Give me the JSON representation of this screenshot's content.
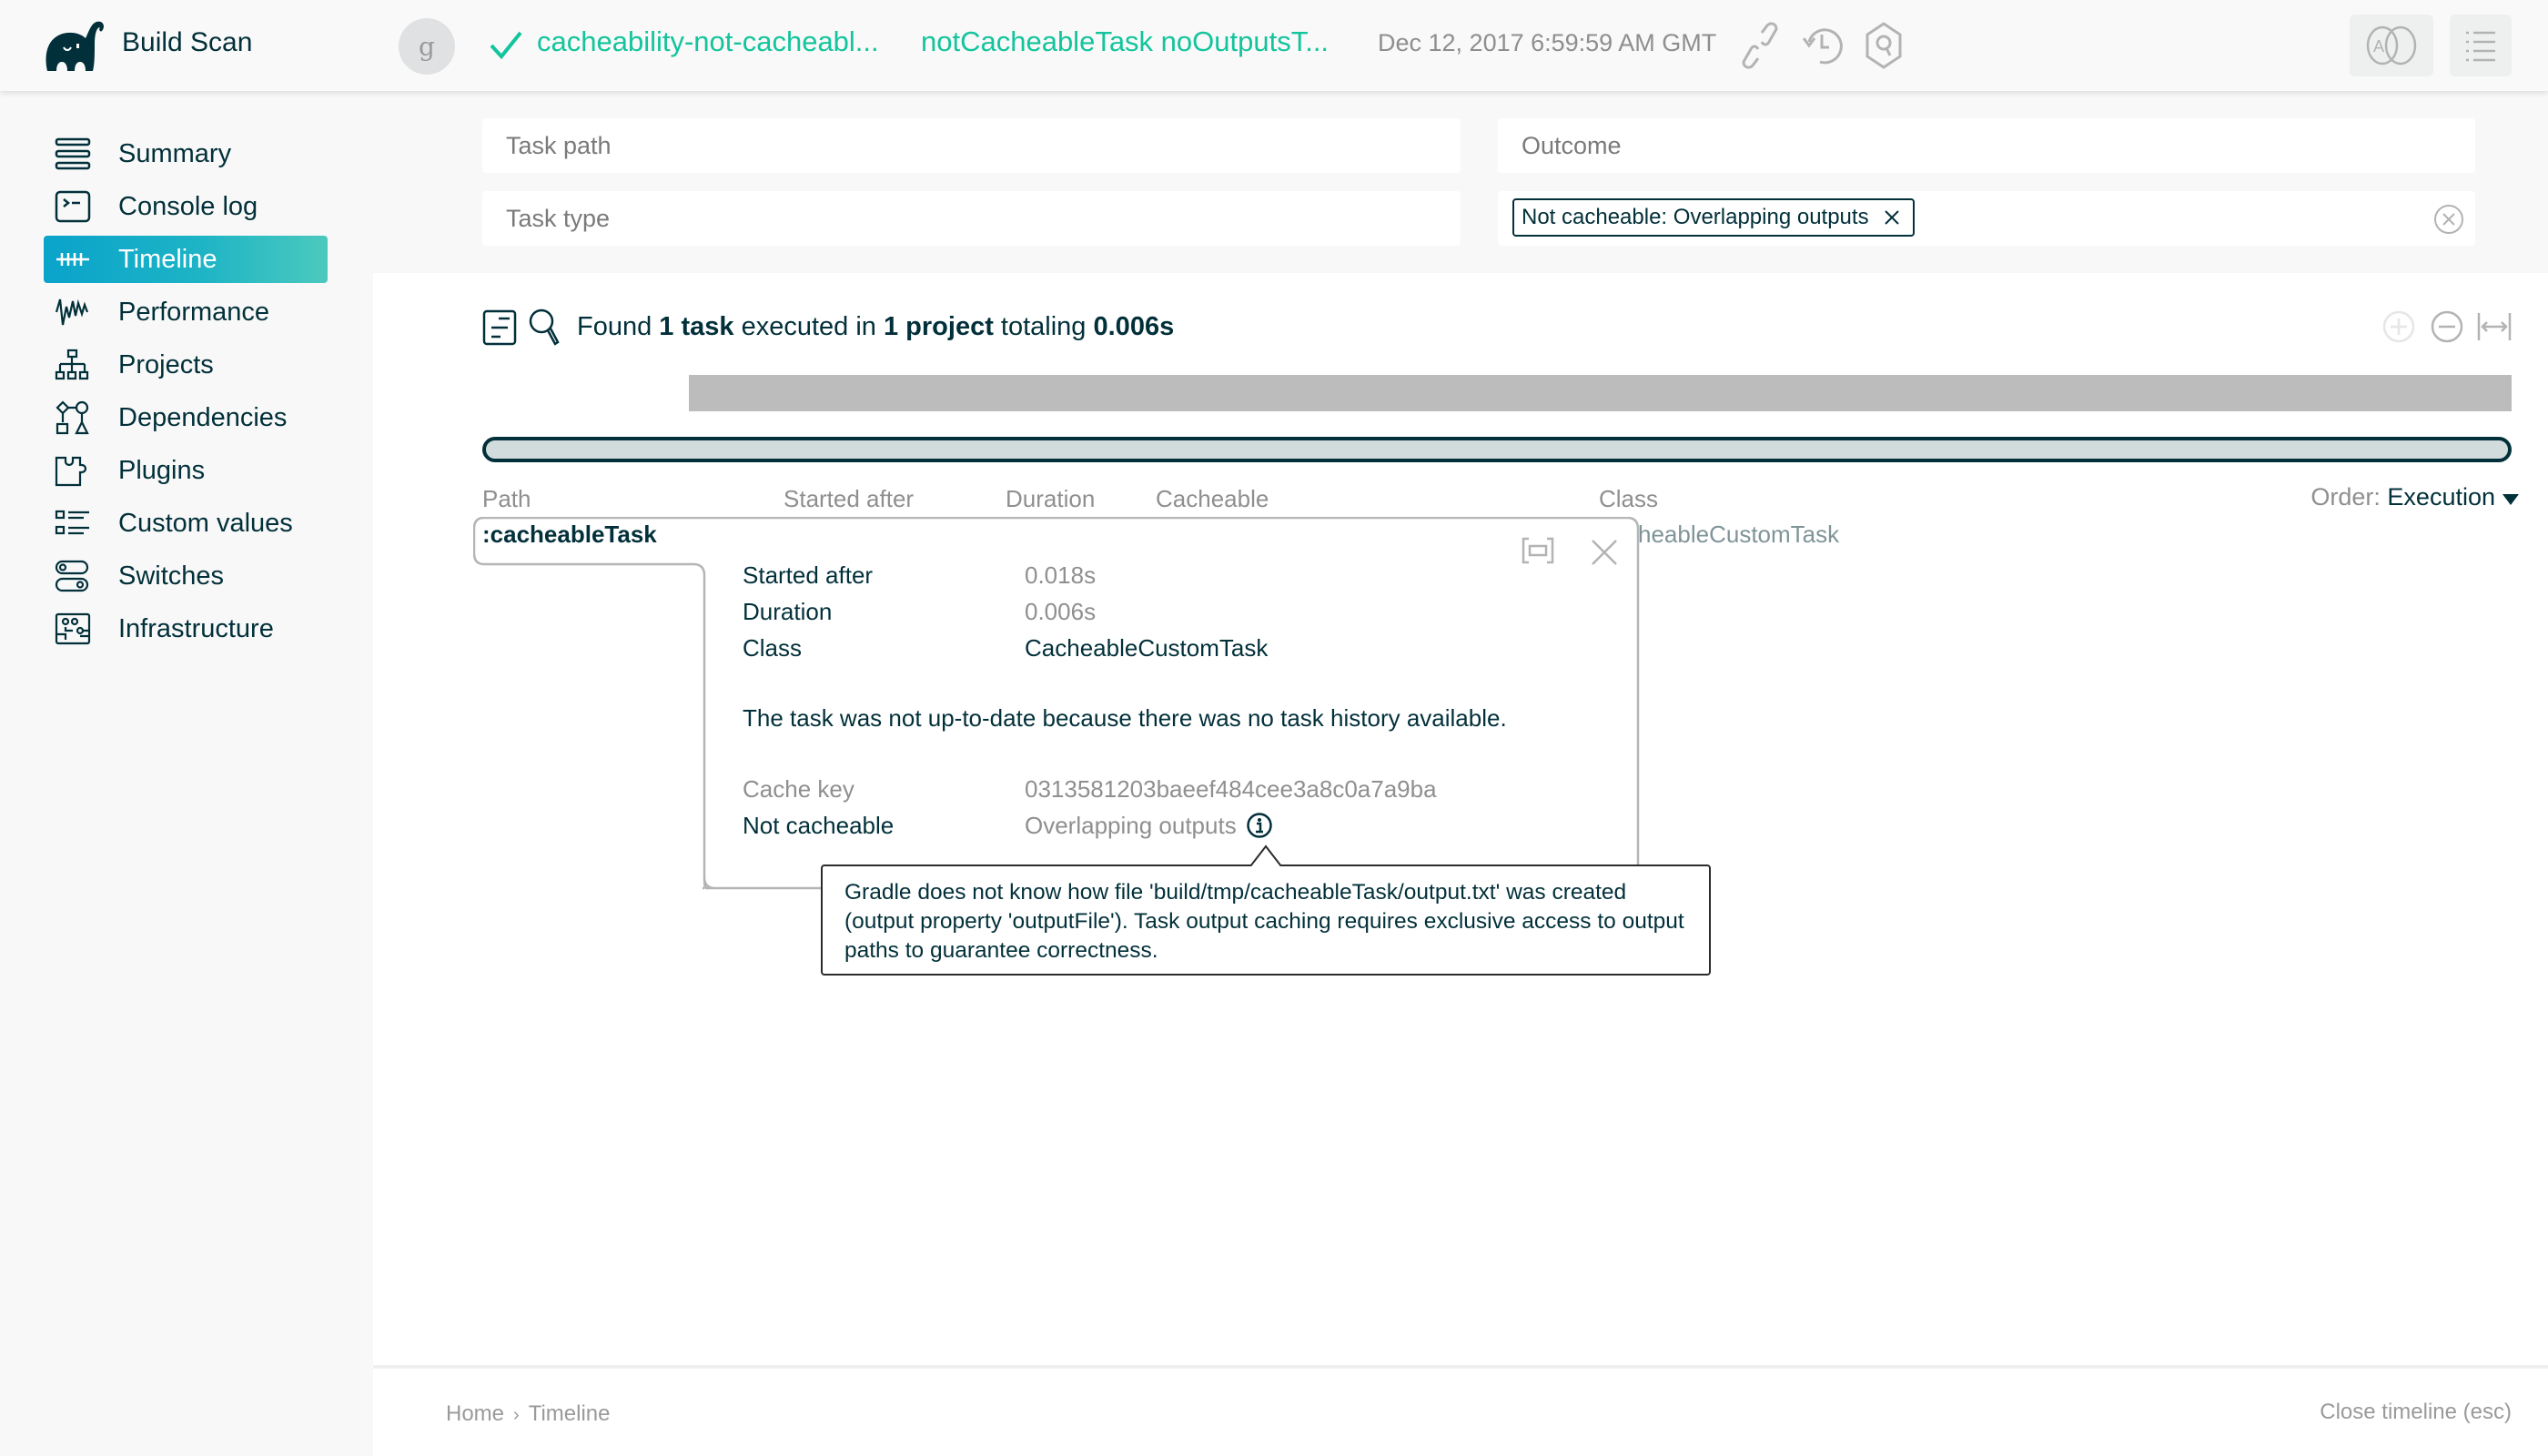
{
  "header": {
    "brand": "Build Scan",
    "avatar_letter": "g",
    "scan_tag": "cacheability-not-cacheabl...",
    "scan_tasks": "notCacheableTask noOutputsT...",
    "scan_date": "Dec 12, 2017 6:59:59 AM GMT",
    "status": "success",
    "accent_color": "#13c49c"
  },
  "sidebar": {
    "items": [
      {
        "label": "Summary",
        "icon": "summary-icon",
        "active": false
      },
      {
        "label": "Console log",
        "icon": "console-icon",
        "active": false
      },
      {
        "label": "Timeline",
        "icon": "timeline-icon",
        "active": true
      },
      {
        "label": "Performance",
        "icon": "performance-icon",
        "active": false
      },
      {
        "label": "Projects",
        "icon": "projects-icon",
        "active": false
      },
      {
        "label": "Dependencies",
        "icon": "dependencies-icon",
        "active": false
      },
      {
        "label": "Plugins",
        "icon": "plugins-icon",
        "active": false
      },
      {
        "label": "Custom values",
        "icon": "custom-values-icon",
        "active": false
      },
      {
        "label": "Switches",
        "icon": "switches-icon",
        "active": false
      },
      {
        "label": "Infrastructure",
        "icon": "infrastructure-icon",
        "active": false
      }
    ]
  },
  "filters": {
    "task_path": {
      "placeholder": "Task path",
      "value": ""
    },
    "task_type": {
      "placeholder": "Task type",
      "value": ""
    },
    "outcome": {
      "placeholder": "Outcome",
      "value": ""
    },
    "selected_chip": "Not cacheable: Overlapping outputs"
  },
  "summary": {
    "prefix": "Found ",
    "task_count": "1 task",
    "mid1": " executed in ",
    "project_count": "1 project",
    "mid2": " totaling ",
    "total": "0.006s"
  },
  "columns": {
    "path": "Path",
    "started_after": "Started after",
    "duration": "Duration",
    "cacheable": "Cacheable",
    "class": "Class",
    "order_label": "Order:",
    "order_value": "Execution"
  },
  "rows": [
    {
      "path": ":cacheableTask",
      "class_visible": "heableCustomTask"
    }
  ],
  "popup": {
    "task": ":cacheableTask",
    "started_after_label": "Started after",
    "started_after": "0.018s",
    "duration_label": "Duration",
    "duration": "0.006s",
    "class_label": "Class",
    "class": "CacheableCustomTask",
    "message": "The task was not up-to-date because there was no task history available.",
    "cache_key_label": "Cache key",
    "cache_key": "0313581203baeef484cee3a8c0a7a9ba",
    "not_cacheable_label": "Not cacheable",
    "not_cacheable_reason": "Overlapping outputs"
  },
  "tooltip": {
    "text": "Gradle does not know how file 'build/tmp/cacheableTask/output.txt' was created (output property 'outputFile'). Task output caching requires exclusive access to output paths to guarantee correctness."
  },
  "footer": {
    "breadcrumb": [
      "Home",
      "Timeline"
    ],
    "close_label": "Close timeline (esc)"
  }
}
